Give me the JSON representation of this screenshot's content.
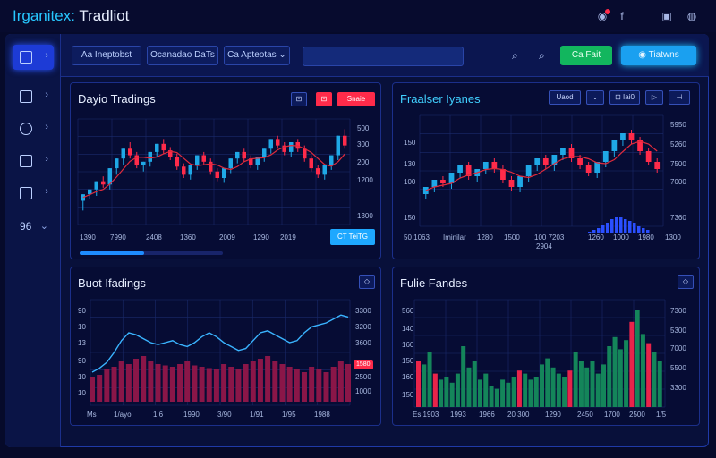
{
  "app": {
    "title_accent": "Irganitex:",
    "title_rest": " Tradliot"
  },
  "titlebar": {
    "icons": [
      "notification-icon",
      "facebook-icon",
      "image-icon",
      "globe-icon"
    ],
    "glyphs": [
      "◉",
      "f",
      "▣",
      "◍"
    ]
  },
  "sidebar": {
    "items": [
      {
        "name": "sidebar-item-trade",
        "chev": "›",
        "active": true
      },
      {
        "name": "sidebar-item-markets",
        "chev": "›",
        "active": false
      },
      {
        "name": "sidebar-item-tools",
        "chev": "›",
        "active": false
      },
      {
        "name": "sidebar-item-portfolio",
        "chev": "›",
        "active": false
      },
      {
        "name": "sidebar-item-orders",
        "chev": "›",
        "active": false
      },
      {
        "name": "sidebar-item-settings",
        "label": "96",
        "chev": "⌄",
        "active": false
      }
    ]
  },
  "topbar": {
    "tab1": "Aa Ineptobst",
    "tab2": "Ocanadao DaTs",
    "tab3": "Ca Apteotas  ⌄",
    "green_btn": "Ca  Fait",
    "cyan_btn": "◉  Tiatwns",
    "search_glyph": "⌕"
  },
  "panel1": {
    "title": "Dayio Tradings",
    "btn1": "⊡",
    "btn2": "⊡",
    "btn3": "Snaie",
    "y_ticks": [
      "500",
      "300",
      "200",
      "1200",
      "1300"
    ],
    "x_ticks": [
      "1390",
      "7990",
      "2408",
      "1360",
      "2009",
      "1290",
      "2019"
    ],
    "action": "CT  TeiTG",
    "progress": 0.45,
    "colors": {
      "up": "#1fa8e6",
      "down": "#ff2b4a",
      "avg": "#e02b3c",
      "grid": "#1a2a6a"
    }
  },
  "panel2": {
    "title": "Fraalser Iyanes",
    "btn1": "Uaod",
    "btn2": "⌄",
    "btn3": "⊡ Iai0",
    "btn4": "▷",
    "btn5": "⊣",
    "y_left": [
      "150",
      "130",
      "100",
      "150"
    ],
    "y_right": [
      "5950",
      "5260",
      "7500",
      "7000",
      "7360"
    ],
    "x_ticks": [
      "50 1063",
      "Iminilar",
      "1280",
      "1500",
      "100 7203",
      "1260",
      "1000",
      "1980",
      "1300"
    ],
    "x_sub": "2904"
  },
  "panel3": {
    "title": "Buot Ifadings",
    "y_left": [
      "90",
      "10",
      "13",
      "90",
      "10",
      "10"
    ],
    "y_right": [
      "3300",
      "3200",
      "3600",
      "2000",
      "2500",
      "1000"
    ],
    "badge": "1580",
    "x_ticks": [
      "Ms",
      "1/ayo",
      "1:6",
      "1990",
      "3/90",
      "1/91",
      "1/95",
      "1988"
    ]
  },
  "panel4": {
    "title": "Fulie Fandes",
    "y_left": [
      "560",
      "140",
      "160",
      "150",
      "160",
      "150"
    ],
    "y_right": [
      "7300",
      "5300",
      "7000",
      "5500",
      "3300",
      "3300"
    ],
    "x_ticks": [
      "Es 1903",
      "1993",
      "1966",
      "20 300",
      "1290",
      "2450",
      "1700",
      "2500",
      "1/5"
    ]
  },
  "chart_data": [
    {
      "type": "candlestick",
      "title": "Dayio Tradings",
      "series": [
        {
          "values": [
            [
              48,
              52,
              44,
              42
            ],
            [
              52,
              55,
              50,
              49
            ],
            [
              55,
              60,
              52,
              51
            ],
            [
              60,
              58,
              63,
              56
            ],
            [
              58,
              68,
              56,
              55
            ],
            [
              68,
              74,
              66,
              64
            ],
            [
              74,
              80,
              72,
              70
            ],
            [
              80,
              76,
              84,
              74
            ],
            [
              76,
              70,
              78,
              68
            ],
            [
              70,
              72,
              68,
              66
            ],
            [
              72,
              78,
              70,
              69
            ],
            [
              78,
              83,
              76,
              75
            ],
            [
              83,
              79,
              86,
              77
            ],
            [
              79,
              75,
              81,
              73
            ],
            [
              75,
              69,
              77,
              67
            ],
            [
              69,
              64,
              71,
              62
            ],
            [
              64,
              70,
              62,
              61
            ],
            [
              70,
              76,
              68,
              67
            ],
            [
              76,
              72,
              78,
              70
            ],
            [
              72,
              66,
              74,
              64
            ],
            [
              66,
              62,
              68,
              60
            ],
            [
              62,
              68,
              60,
              59
            ],
            [
              68,
              74,
              66,
              65
            ],
            [
              74,
              78,
              72,
              71
            ],
            [
              78,
              74,
              80,
              72
            ],
            [
              74,
              70,
              76,
              68
            ],
            [
              70,
              75,
              68,
              67
            ],
            [
              75,
              80,
              73,
              72
            ],
            [
              80,
              86,
              78,
              77
            ],
            [
              86,
              82,
              88,
              80
            ],
            [
              82,
              78,
              84,
              76
            ],
            [
              78,
              84,
              76,
              75
            ],
            [
              84,
              80,
              86,
              78
            ],
            [
              80,
              74,
              82,
              72
            ],
            [
              74,
              68,
              76,
              66
            ],
            [
              68,
              64,
              70,
              62
            ],
            [
              64,
              70,
              62,
              61
            ],
            [
              70,
              76,
              68,
              67
            ],
            [
              76,
              88,
              74,
              73
            ],
            [
              88,
              82,
              92,
              80
            ]
          ]
        }
      ],
      "ylim": [
        40,
        95
      ]
    },
    {
      "type": "candlestick",
      "title": "Fraalser Iyanes",
      "series": [
        {
          "values": [
            [
              40,
              44,
              38,
              37
            ],
            [
              44,
              48,
              42,
              41
            ],
            [
              48,
              46,
              50,
              44
            ],
            [
              46,
              52,
              44,
              43
            ],
            [
              52,
              56,
              50,
              49
            ],
            [
              56,
              50,
              58,
              48
            ],
            [
              50,
              54,
              48,
              47
            ],
            [
              54,
              58,
              52,
              51
            ],
            [
              58,
              54,
              60,
              52
            ],
            [
              54,
              48,
              56,
              46
            ],
            [
              48,
              44,
              50,
              42
            ],
            [
              44,
              50,
              42,
              41
            ],
            [
              50,
              56,
              48,
              47
            ],
            [
              56,
              60,
              54,
              53
            ],
            [
              60,
              56,
              62,
              54
            ],
            [
              56,
              62,
              54,
              53
            ],
            [
              62,
              66,
              60,
              59
            ],
            [
              66,
              60,
              68,
              58
            ],
            [
              60,
              56,
              62,
              54
            ],
            [
              56,
              52,
              58,
              50
            ],
            [
              52,
              58,
              50,
              49
            ],
            [
              58,
              64,
              56,
              55
            ],
            [
              64,
              70,
              62,
              61
            ],
            [
              70,
              74,
              68,
              67
            ],
            [
              74,
              70,
              76,
              68
            ],
            [
              70,
              64,
              72,
              62
            ],
            [
              64,
              58,
              66,
              56
            ],
            [
              58,
              54,
              60,
              52
            ]
          ]
        },
        {
          "name": "volume",
          "values": [
            1,
            2,
            3,
            5,
            6,
            8,
            9,
            9,
            8,
            7,
            6,
            4,
            3,
            2
          ]
        }
      ],
      "ylim": [
        30,
        80
      ]
    },
    {
      "type": "line",
      "title": "Buot Ifadings",
      "series": [
        {
          "name": "price",
          "values": [
            30,
            34,
            40,
            50,
            62,
            70,
            68,
            64,
            60,
            58,
            60,
            62,
            58,
            56,
            60,
            66,
            70,
            66,
            60,
            56,
            52,
            54,
            62,
            70,
            72,
            68,
            64,
            60,
            62,
            70,
            76,
            78,
            80,
            84,
            88,
            86
          ]
        },
        {
          "name": "volume",
          "values": [
            18,
            20,
            24,
            26,
            30,
            28,
            32,
            34,
            30,
            28,
            27,
            26,
            28,
            30,
            27,
            26,
            25,
            24,
            28,
            26,
            24,
            28,
            30,
            32,
            34,
            30,
            28,
            26,
            24,
            22,
            26,
            24,
            22,
            26,
            30,
            28
          ]
        }
      ],
      "ylim": [
        0,
        100
      ]
    },
    {
      "type": "bar",
      "title": "Fulie Fandes",
      "series": [
        {
          "values": [
            30,
            28,
            36,
            22,
            18,
            20,
            16,
            22,
            40,
            26,
            30,
            18,
            22,
            14,
            12,
            18,
            16,
            20,
            24,
            22,
            18,
            20,
            28,
            32,
            26,
            22,
            20,
            24,
            36,
            30,
            26,
            30,
            22,
            28,
            40,
            46,
            38,
            44,
            56,
            64,
            48,
            42,
            36,
            30
          ]
        }
      ],
      "highlight": [
        0,
        3,
        18,
        27,
        38,
        41
      ],
      "ylim": [
        0,
        70
      ]
    }
  ]
}
